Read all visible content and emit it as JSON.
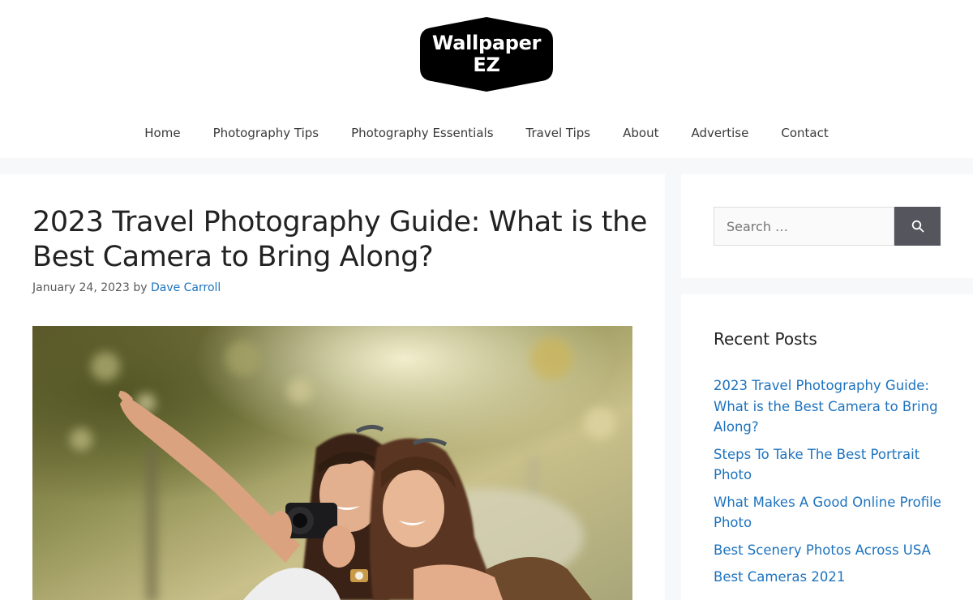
{
  "site": {
    "logo_line1": "Wallpaper",
    "logo_line2": "EZ",
    "logo_color": "#000000"
  },
  "nav": {
    "items": [
      {
        "label": "Home"
      },
      {
        "label": "Photography Tips"
      },
      {
        "label": "Photography Essentials"
      },
      {
        "label": "Travel Tips"
      },
      {
        "label": "About"
      },
      {
        "label": "Advertise"
      },
      {
        "label": "Contact"
      }
    ]
  },
  "article": {
    "title": "2023 Travel Photography Guide: What is the Best Camera to Bring Along?",
    "date": "January 24, 2023",
    "by": "by",
    "author": "Dave Carroll"
  },
  "search": {
    "placeholder": "Search …",
    "icon": "search-icon",
    "button_color": "#55555e"
  },
  "recent_posts": {
    "title": "Recent Posts",
    "items": [
      {
        "label": "2023 Travel Photography Guide: What is the Best Camera to Bring Along?"
      },
      {
        "label": "Steps To Take The Best Portrait Photo"
      },
      {
        "label": "What Makes A Good Online Profile Photo"
      },
      {
        "label": "Best Scenery Photos Across USA"
      },
      {
        "label": "Best Cameras 2021"
      }
    ]
  },
  "colors": {
    "link": "#1e73be",
    "page_background": "#f7f8f9",
    "text": "#222222"
  }
}
